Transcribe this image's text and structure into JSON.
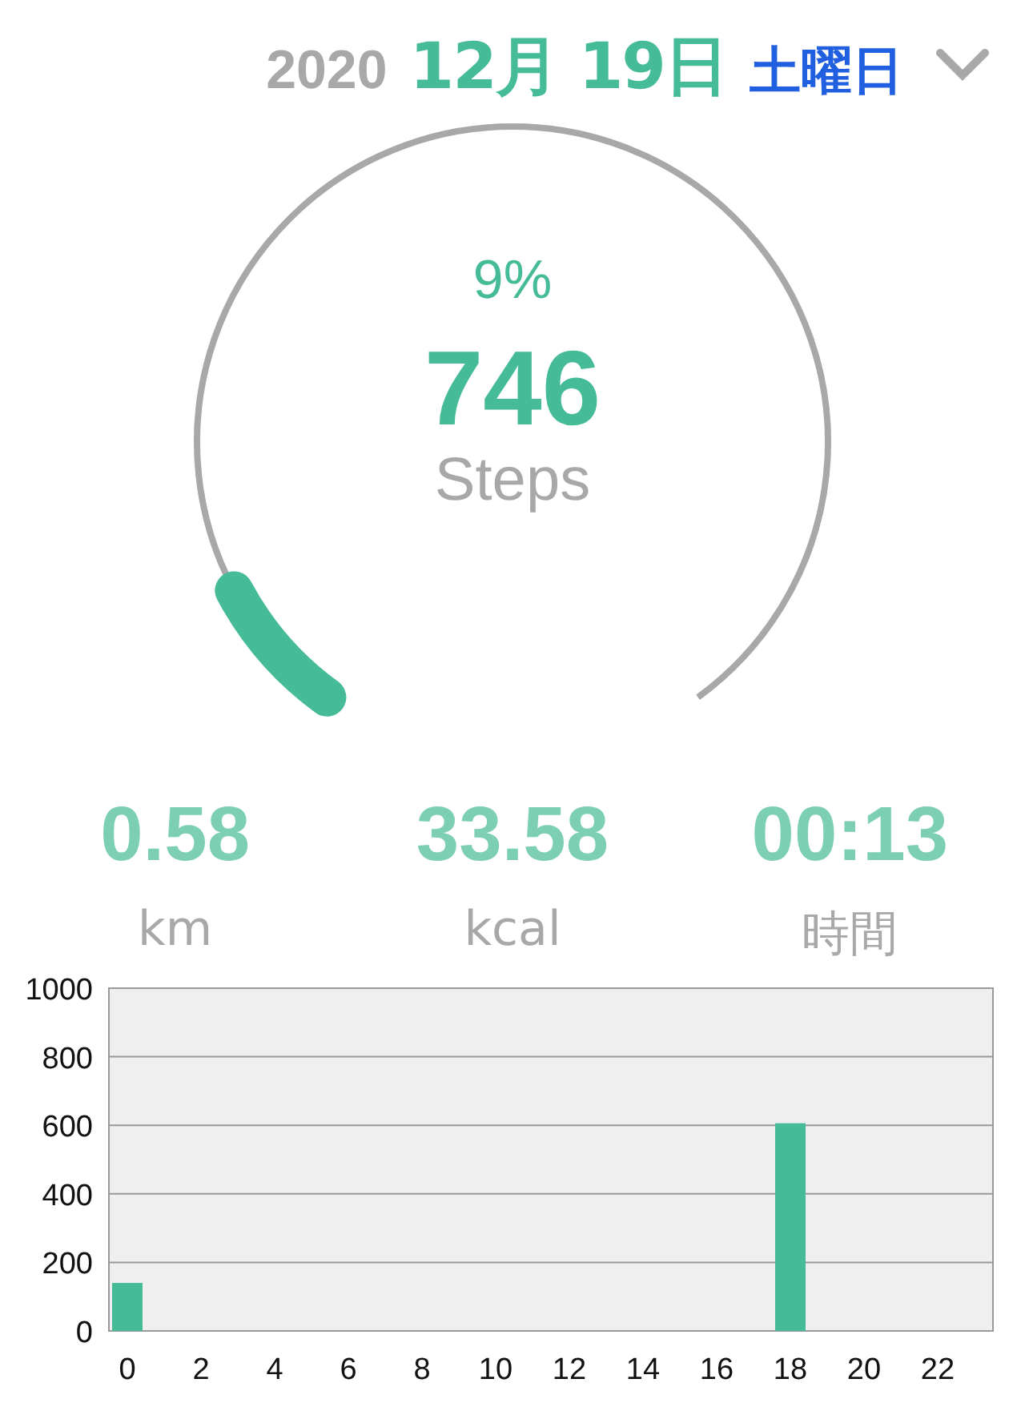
{
  "header": {
    "year": "2020",
    "date": "12月 19日",
    "weekday": "土曜日"
  },
  "progress": {
    "percent": "9%",
    "level": 0.09,
    "steps": "746",
    "unit": "Steps"
  },
  "stats": [
    {
      "value": "0.58",
      "unit": "km"
    },
    {
      "value": "33.58",
      "unit": "kcal"
    },
    {
      "value": "00:13",
      "unit": "時間"
    }
  ],
  "hourly_chart": {
    "chart_data": {
      "type": "bar",
      "x": [
        0,
        1,
        2,
        3,
        4,
        5,
        6,
        7,
        8,
        9,
        10,
        11,
        12,
        13,
        14,
        15,
        16,
        17,
        18,
        19,
        20,
        21,
        22,
        23
      ],
      "grid": true,
      "values": [
        140,
        0,
        0,
        0,
        0,
        0,
        0,
        0,
        0,
        0,
        0,
        0,
        0,
        0,
        0,
        0,
        0,
        0,
        606,
        0,
        0,
        0,
        0,
        0
      ],
      "xlim": [
        -0.5,
        23.5
      ],
      "ylim": [
        0,
        1000
      ],
      "yticks": [
        0,
        200,
        400,
        600,
        800,
        1000
      ],
      "xticks": [
        0,
        2,
        4,
        6,
        8,
        10,
        12,
        14,
        16,
        18,
        20,
        22
      ]
    }
  }
}
